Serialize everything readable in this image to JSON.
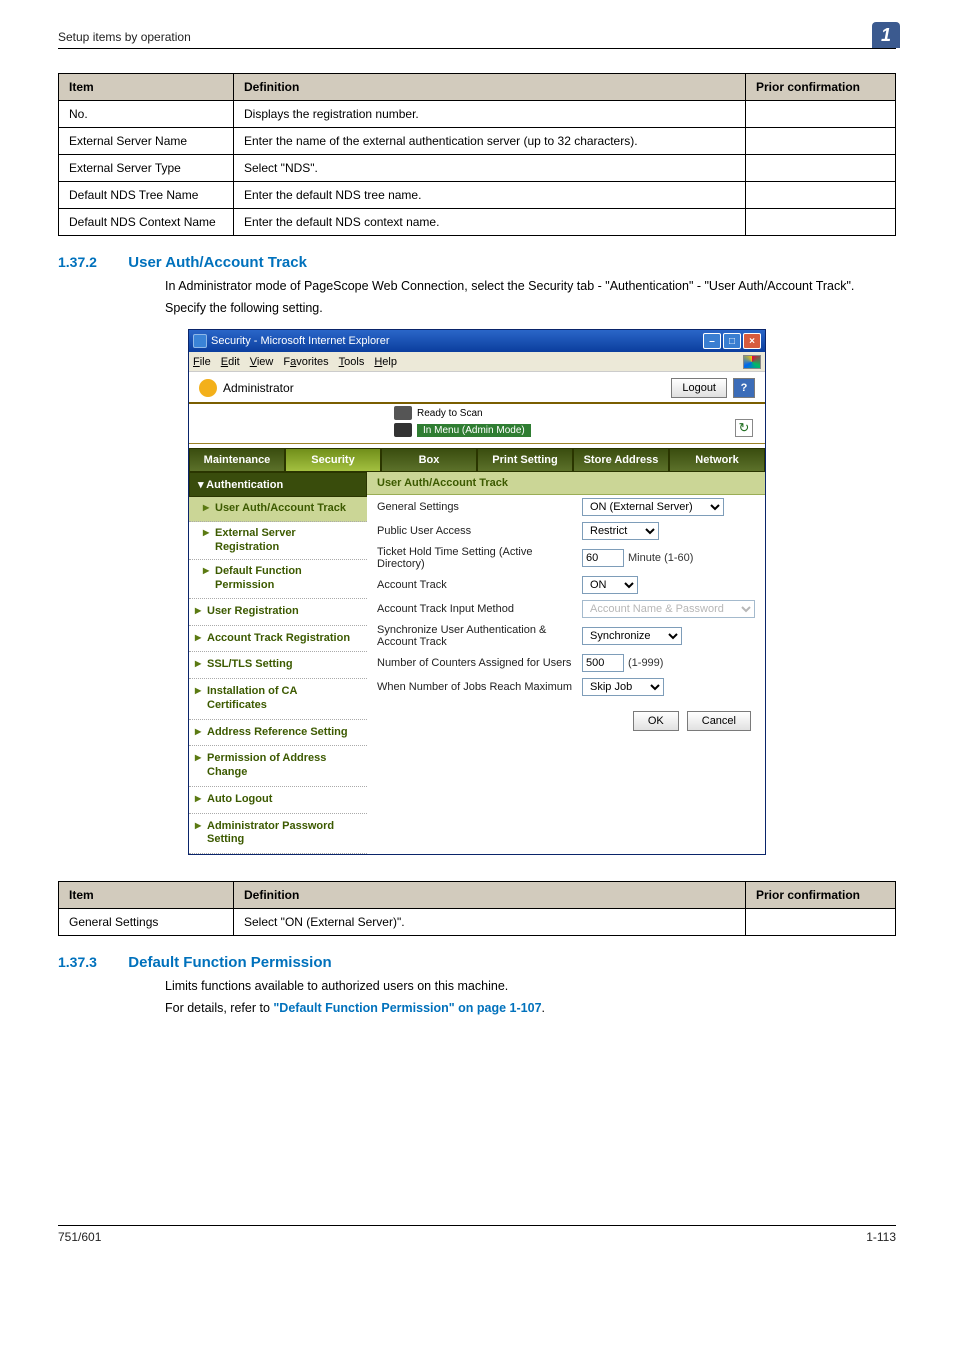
{
  "header": {
    "breadcrumb": "Setup items by operation",
    "chapter": "1"
  },
  "table1": {
    "headers": {
      "item": "Item",
      "definition": "Definition",
      "prior": "Prior confirmation"
    },
    "rows": [
      {
        "item": "No.",
        "definition": "Displays the registration number.",
        "prior": ""
      },
      {
        "item": "External Server Name",
        "definition": "Enter the name of the external authentication server (up to 32 characters).",
        "prior": ""
      },
      {
        "item": "External Server Type",
        "definition": "Select \"NDS\".",
        "prior": ""
      },
      {
        "item": "Default NDS Tree Name",
        "definition": "Enter the default NDS tree name.",
        "prior": ""
      },
      {
        "item": "Default NDS Context Name",
        "definition": "Enter the default NDS context name.",
        "prior": ""
      }
    ]
  },
  "section1": {
    "num": "1.37.2",
    "title": "User Auth/Account Track",
    "p1": "In Administrator mode of PageScope Web Connection, select the Security tab - \"Authentication\" - \"User Auth/Account Track\".",
    "p2": "Specify the following setting."
  },
  "ie": {
    "title": "Security - Microsoft Internet Explorer",
    "menus": {
      "file": "File",
      "edit": "Edit",
      "view": "View",
      "favorites": "Favorites",
      "tools": "Tools",
      "help": "Help"
    },
    "admin": "Administrator",
    "logout": "Logout",
    "help": "?",
    "status_ready": "Ready to Scan",
    "status_mode": "In Menu (Admin Mode)",
    "tabs": {
      "maintenance": "Maintenance",
      "security": "Security",
      "box": "Box",
      "print": "Print Setting",
      "store": "Store Address",
      "network": "Network"
    },
    "sidebar": {
      "header": "Authentication",
      "items": {
        "uaat": "User Auth/Account Track",
        "extserv": "External Server Registration",
        "defperm": "Default Function Permission",
        "userreg": "User Registration",
        "acctreg": "Account Track Registration",
        "ssl": "SSL/TLS Setting",
        "cacert": "Installation of CA Certificates",
        "addrref": "Address Reference Setting",
        "permaddr": "Permission of Address Change",
        "autologout": "Auto Logout",
        "adminpw": "Administrator Password Setting"
      }
    },
    "panel": {
      "header": "User Auth/Account Track",
      "rows": {
        "general": {
          "label": "General Settings",
          "value": "ON (External Server)"
        },
        "pua": {
          "label": "Public User Access",
          "value": "Restrict"
        },
        "thts": {
          "label": "Ticket Hold Time Setting (Active Directory)",
          "value": "60",
          "suffix": "Minute (1-60)"
        },
        "at": {
          "label": "Account Track",
          "value": "ON"
        },
        "atim": {
          "label": "Account Track Input Method",
          "value": "Account Name & Password"
        },
        "sync": {
          "label": "Synchronize User Authentication & Account Track",
          "value": "Synchronize"
        },
        "numcnt": {
          "label": "Number of Counters Assigned for Users",
          "value": "500",
          "suffix": "(1-999)"
        },
        "maxjobs": {
          "label": "When Number of Jobs Reach Maximum",
          "value": "Skip Job"
        }
      },
      "ok": "OK",
      "cancel": "Cancel"
    }
  },
  "table2": {
    "headers": {
      "item": "Item",
      "definition": "Definition",
      "prior": "Prior confirmation"
    },
    "rows": [
      {
        "item": "General Settings",
        "definition": "Select \"ON (External Server)\".",
        "prior": ""
      }
    ]
  },
  "section2": {
    "num": "1.37.3",
    "title": "Default Function Permission",
    "p1": "Limits functions available to authorized users on this machine.",
    "p2_prefix": "For details, refer to ",
    "p2_link": "\"Default Function Permission\" on page 1-107",
    "p2_suffix": "."
  },
  "footer": {
    "left": "751/601",
    "right": "1-113"
  }
}
